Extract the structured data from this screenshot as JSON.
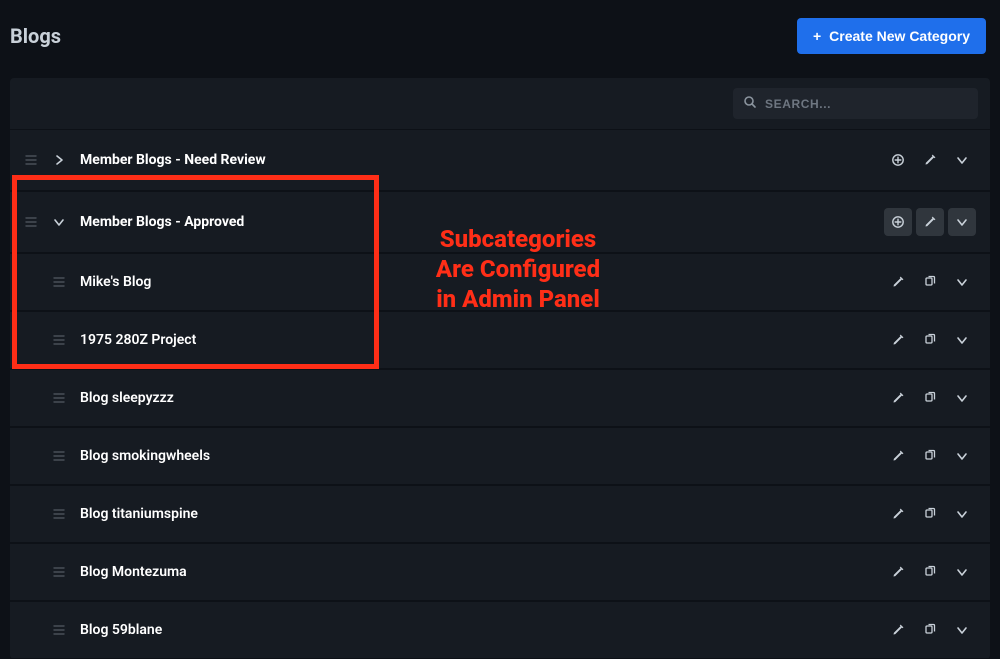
{
  "header": {
    "title": "Blogs",
    "create_button_label": "Create New Category"
  },
  "search": {
    "placeholder": "SEARCH..."
  },
  "categories": [
    {
      "title": "Member Blogs - Need Review",
      "expanded": false
    },
    {
      "title": "Member Blogs - Approved",
      "expanded": true
    }
  ],
  "sub_items": [
    {
      "title": "Mike's Blog"
    },
    {
      "title": "1975 280Z Project"
    },
    {
      "title": "Blog sleepyzzz"
    },
    {
      "title": "Blog smokingwheels"
    },
    {
      "title": "Blog titaniumspine"
    },
    {
      "title": "Blog Montezuma"
    },
    {
      "title": "Blog 59blane"
    }
  ],
  "annotation": {
    "line1": "Subcategories",
    "line2": "Are Configured",
    "line3": "in Admin Panel"
  }
}
